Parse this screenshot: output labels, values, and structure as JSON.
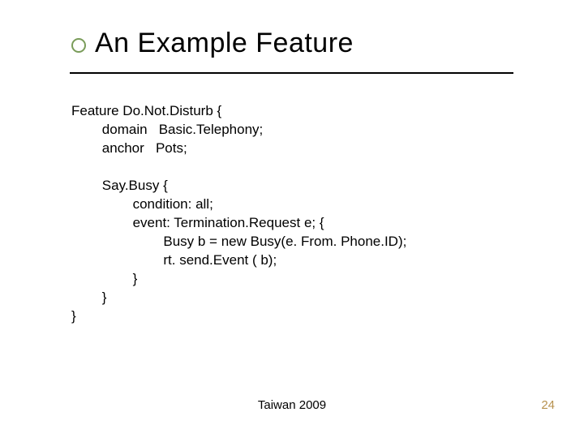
{
  "slide": {
    "title": "An Example Feature",
    "body": "Feature Do.Not.Disturb {\n\tdomain   Basic.Telephony;\n\tanchor   Pots;\n\n\tSay.Busy {\n\t\tcondition: all;\n\t\tevent: Termination.Request e; {\n\t\t\tBusy b = new Busy(e. From. Phone.ID);\n\t\t\trt. send.Event ( b);\n\t\t}\n\t}\n}",
    "footer": "Taiwan 2009",
    "pagenum": "24"
  }
}
